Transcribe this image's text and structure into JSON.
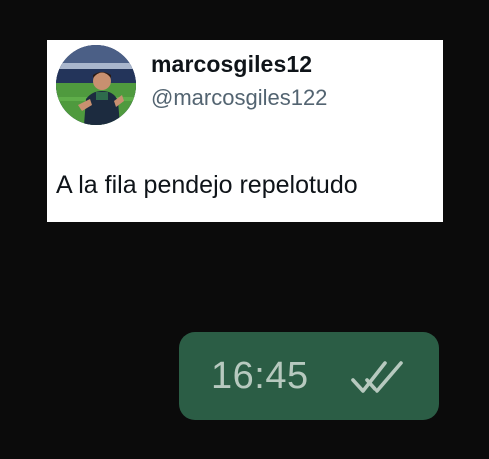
{
  "tweet": {
    "display_name": "marcosgiles12",
    "handle": "@marcosgiles122",
    "text": "A la fila pendejo repelotudo"
  },
  "message": {
    "time": "16:45",
    "status_icon": "double-check-icon",
    "bubble_color": "#2b5d45"
  }
}
